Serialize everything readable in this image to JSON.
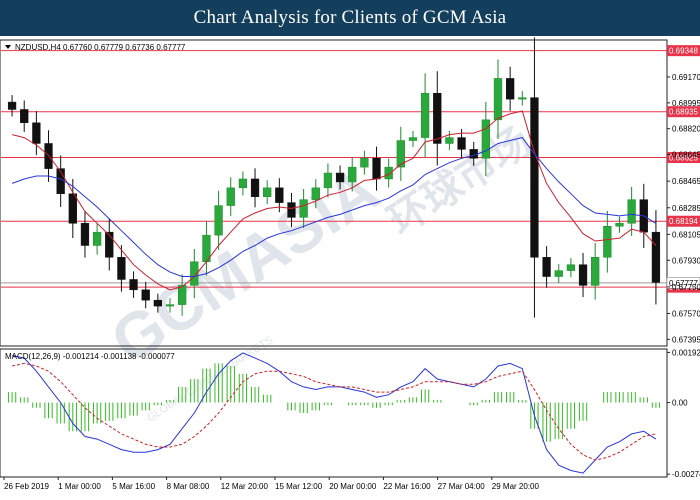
{
  "banner": {
    "title": "Chart Analysis for Clients of GCM Asia"
  },
  "watermark": {
    "main": "GCMASIA",
    "chinese": "环球市场",
    "sub": "GLOBAL CAPITAL MARKETS"
  },
  "chart_data": [
    {
      "type": "candlestick",
      "title": "NZDUSD,H4  0.67760 0.67779 0.67736 0.67777",
      "symbol": "NZDUSD,H4",
      "ohlc_last": {
        "open": 0.6776,
        "high": 0.67779,
        "low": 0.67736,
        "close": 0.67777
      },
      "ylim": [
        0.6735,
        0.6942
      ],
      "y_ticks": [
        "0.69170",
        "0.68995",
        "0.68820",
        "0.68645",
        "0.68465",
        "0.68285",
        "0.68105",
        "0.67930",
        "0.67750",
        "0.67570",
        "0.67395"
      ],
      "x_ticks": [
        "26 Feb 2019",
        "1 Mar 00:00",
        "5 Mar 16:00",
        "8 Mar 08:00",
        "12 Mar 20:00",
        "15 Mar 12:00",
        "20 Mar 00:00",
        "22 Mar 16:00",
        "27 Mar 04:00",
        "29 Mar 20:00"
      ],
      "horizontal_levels": [
        {
          "value": 0.69348,
          "label": "0.69348",
          "color": "#e8344a"
        },
        {
          "value": 0.68935,
          "label": "0.68935",
          "color": "#e8344a"
        },
        {
          "value": 0.68625,
          "label": "0.68625",
          "color": "#e8344a"
        },
        {
          "value": 0.68194,
          "label": "0.68194",
          "color": "#e8344a"
        },
        {
          "value": 0.67748,
          "label": "0.67748",
          "color": "#e8344a"
        }
      ],
      "current_price": {
        "value": 0.67777,
        "label": "0.67777"
      },
      "series": [
        {
          "name": "Price",
          "color": "#000000",
          "values": [
            0.6895,
            0.6886,
            0.6872,
            0.6855,
            0.6838,
            0.6818,
            0.6803,
            0.6812,
            0.6795,
            0.678,
            0.6773,
            0.6766,
            0.6762,
            0.6763,
            0.6776,
            0.6792,
            0.681,
            0.683,
            0.6842,
            0.6848,
            0.6836,
            0.6842,
            0.6832,
            0.6822,
            0.6834,
            0.6842,
            0.6852,
            0.6846,
            0.6856,
            0.6862,
            0.6848,
            0.6856,
            0.6874,
            0.6876,
            0.6906,
            0.6872,
            0.6876,
            0.6868,
            0.6862,
            0.6888,
            0.6916,
            0.6902,
            0.6903,
            0.6795,
            0.6782,
            0.6786,
            0.679,
            0.6776,
            0.6795,
            0.6816,
            0.6818,
            0.6834,
            0.6812,
            0.6778
          ]
        },
        {
          "name": "MA fast",
          "color": "#cc1f2e",
          "values": [
            0.6878,
            0.6876,
            0.6871,
            0.6864,
            0.6853,
            0.6839,
            0.6826,
            0.6818,
            0.681,
            0.68,
            0.679,
            0.6783,
            0.6777,
            0.6773,
            0.6775,
            0.6782,
            0.6792,
            0.6803,
            0.6812,
            0.6821,
            0.6825,
            0.6828,
            0.6829,
            0.6828,
            0.683,
            0.6833,
            0.6837,
            0.6839,
            0.6842,
            0.6847,
            0.6848,
            0.6851,
            0.6858,
            0.6862,
            0.6873,
            0.6875,
            0.6878,
            0.6879,
            0.6879,
            0.6882,
            0.6889,
            0.6892,
            0.6894,
            0.6866,
            0.6845,
            0.6832,
            0.6822,
            0.6811,
            0.6806,
            0.6807,
            0.6808,
            0.6814,
            0.6812,
            0.6803
          ]
        },
        {
          "name": "MA slow",
          "color": "#2a35d8",
          "values": [
            0.6845,
            0.6848,
            0.685,
            0.685,
            0.6848,
            0.6843,
            0.6836,
            0.6829,
            0.6821,
            0.6813,
            0.6805,
            0.6797,
            0.679,
            0.6785,
            0.6782,
            0.6782,
            0.6784,
            0.6788,
            0.6793,
            0.6799,
            0.6803,
            0.6808,
            0.6811,
            0.6813,
            0.6816,
            0.6819,
            0.6822,
            0.6824,
            0.6827,
            0.683,
            0.6832,
            0.6835,
            0.684,
            0.6844,
            0.6851,
            0.6855,
            0.6859,
            0.6862,
            0.6864,
            0.6867,
            0.6872,
            0.6874,
            0.6876,
            0.6865,
            0.6855,
            0.6846,
            0.6838,
            0.683,
            0.6825,
            0.6824,
            0.6823,
            0.6824,
            0.6823,
            0.6818
          ]
        }
      ]
    },
    {
      "type": "line",
      "title": "MACD(12,26,9) -0.001214 -0.001138 -0.000077",
      "indicator": "MACD(12,26,9)",
      "readout": [
        "-0.001214",
        "-0.001138",
        "-0.000077"
      ],
      "ylim": [
        -0.00285,
        0.00205
      ],
      "y_ticks": [
        "0.00192",
        "0.00",
        "-0.00274"
      ],
      "series": [
        {
          "name": "MACD",
          "color": "#2a35d8",
          "values": [
            0.0018,
            0.0017,
            0.0012,
            0.0006,
            0.0,
            -0.0008,
            -0.0013,
            -0.0014,
            -0.0016,
            -0.0018,
            -0.0019,
            -0.0019,
            -0.0018,
            -0.0016,
            -0.001,
            -0.0004,
            0.0004,
            0.0011,
            0.0016,
            0.0019,
            0.0017,
            0.0015,
            0.0012,
            0.0008,
            0.0006,
            0.0005,
            0.0006,
            0.0006,
            0.0005,
            0.0004,
            0.0002,
            0.0003,
            0.0006,
            0.0008,
            0.0013,
            0.0009,
            0.0008,
            0.0007,
            0.0006,
            0.0009,
            0.0014,
            0.0015,
            0.0013,
            -0.0005,
            -0.0018,
            -0.0024,
            -0.0026,
            -0.0027,
            -0.0022,
            -0.0017,
            -0.0015,
            -0.0012,
            -0.0011,
            -0.0014
          ]
        },
        {
          "name": "Signal",
          "color": "#cc2222",
          "values": [
            0.0014,
            0.0015,
            0.0014,
            0.0012,
            0.0008,
            0.0003,
            -0.0002,
            -0.0006,
            -0.0009,
            -0.0012,
            -0.0014,
            -0.0016,
            -0.0017,
            -0.0017,
            -0.0016,
            -0.0013,
            -0.0009,
            -0.0004,
            0.0002,
            0.0008,
            0.0011,
            0.0012,
            0.0012,
            0.0011,
            0.001,
            0.0008,
            0.0007,
            0.0006,
            0.0006,
            0.0005,
            0.0004,
            0.0004,
            0.0005,
            0.0006,
            0.0008,
            0.0008,
            0.0008,
            0.0007,
            0.0007,
            0.0008,
            0.001,
            0.0011,
            0.0012,
            0.0005,
            -0.0003,
            -0.001,
            -0.0016,
            -0.002,
            -0.0022,
            -0.0021,
            -0.0019,
            -0.0016,
            -0.0013,
            -0.0012
          ]
        },
        {
          "name": "Histogram",
          "color": "#33bb22",
          "values": [
            0.0004,
            0.0002,
            -0.0002,
            -0.0006,
            -0.0008,
            -0.0011,
            -0.0011,
            -0.0008,
            -0.0007,
            -0.0006,
            -0.0005,
            -0.0003,
            -0.0001,
            0.0001,
            0.0006,
            0.0009,
            0.0013,
            0.0015,
            0.0014,
            0.0011,
            0.0006,
            0.0003,
            0.0,
            -0.0003,
            -0.0004,
            -0.0003,
            -0.0001,
            0.0,
            -0.0001,
            -0.0001,
            -0.0002,
            -0.0001,
            0.0001,
            0.0002,
            0.0005,
            0.0001,
            0.0,
            0.0,
            -0.0001,
            0.0001,
            0.0004,
            0.0004,
            0.0001,
            -0.001,
            -0.0015,
            -0.0014,
            -0.001,
            -0.0007,
            0.0,
            0.0004,
            0.0004,
            0.0004,
            0.0002,
            -0.0002
          ]
        }
      ]
    }
  ]
}
